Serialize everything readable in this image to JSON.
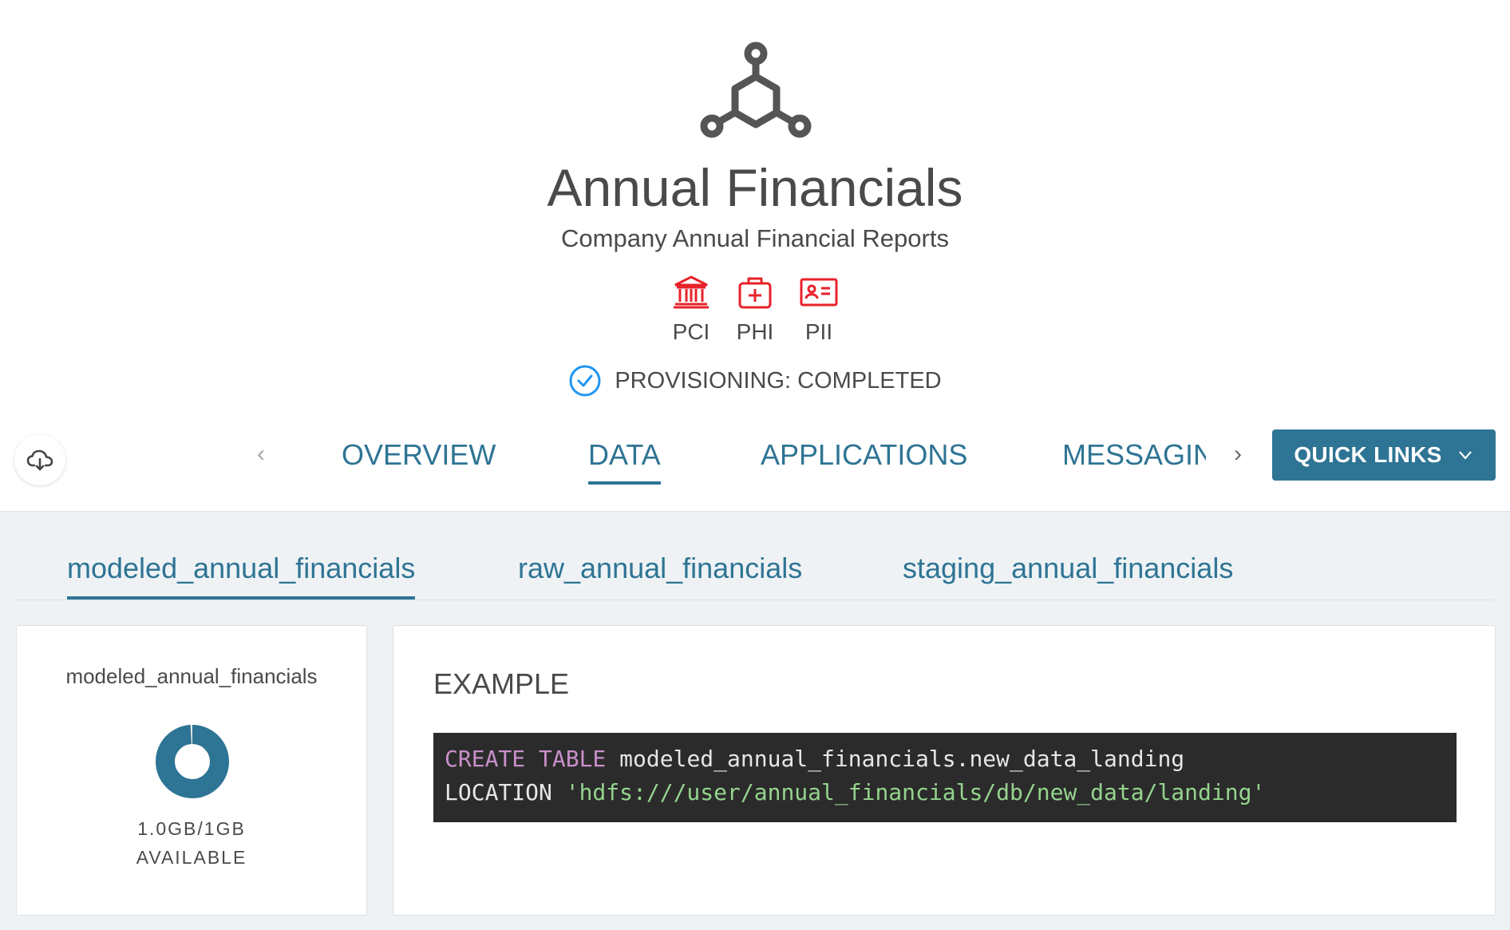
{
  "header": {
    "title": "Annual Financials",
    "subtitle": "Company Annual Financial Reports",
    "logo_icon": "network-hub-icon",
    "tags": [
      {
        "label": "PCI",
        "icon": "bank-icon",
        "color": "#e8222a"
      },
      {
        "label": "PHI",
        "icon": "medical-kit-icon",
        "color": "#e8222a"
      },
      {
        "label": "PII",
        "icon": "id-card-icon",
        "color": "#e8222a"
      }
    ],
    "status": {
      "text": "PROVISIONING: COMPLETED",
      "icon": "check-circle-icon",
      "color": "#2196f3"
    }
  },
  "nav": {
    "tabs": [
      {
        "label": "OVERVIEW"
      },
      {
        "label": "DATA",
        "active": true
      },
      {
        "label": "APPLICATIONS"
      },
      {
        "label": "MESSAGING"
      }
    ],
    "quick_links_label": "QUICK LINKS",
    "cloud_icon": "cloud-download-icon",
    "prev_icon": "chevron-left-icon",
    "next_icon": "chevron-right-icon"
  },
  "data_tabs": [
    {
      "label": "modeled_annual_financials",
      "active": true
    },
    {
      "label": "raw_annual_financials"
    },
    {
      "label": "staging_annual_financials"
    }
  ],
  "database_card": {
    "name": "modeled_annual_financials",
    "usage_line1": "1.0GB/1GB",
    "usage_line2": "AVAILABLE",
    "used_fraction": 0.99
  },
  "example": {
    "label": "EXAMPLE",
    "line1_kw": "CREATE TABLE",
    "line1_rest": " modeled_annual_financials.new_data_landing",
    "line2_kw": "LOCATION",
    "line2_str": "'hdfs:///user/annual_financials/db/new_data/landing'"
  },
  "colors": {
    "accent": "#2e7494",
    "sensitive": "#e8222a",
    "status": "#2196f3",
    "content_bg": "#eef2f5"
  }
}
